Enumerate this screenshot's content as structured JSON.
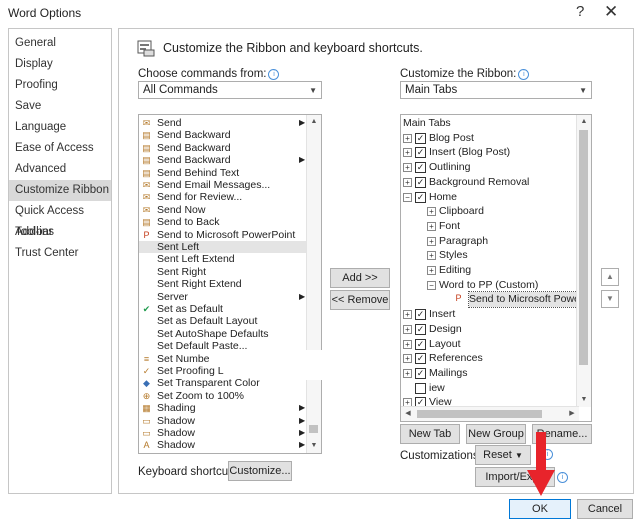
{
  "window": {
    "title": "Word Options",
    "help": "?",
    "close": "✕"
  },
  "sidebar": {
    "items": [
      {
        "label": "General"
      },
      {
        "label": "Display"
      },
      {
        "label": "Proofing"
      },
      {
        "label": "Save"
      },
      {
        "label": "Language"
      },
      {
        "label": "Ease of Access"
      },
      {
        "label": "Advanced"
      },
      {
        "label": "Customize Ribbon"
      },
      {
        "label": "Quick Access Toolbar"
      },
      {
        "label": "Add-ins"
      },
      {
        "label": "Trust Center"
      }
    ],
    "selected": "Customize Ribbon"
  },
  "header": {
    "title": "Customize the Ribbon and keyboard shortcuts."
  },
  "left": {
    "label": "Choose commands from:",
    "dropdown_value": "All Commands",
    "commands": [
      {
        "label": "Send",
        "icon": "envelope-icon",
        "submenu": true
      },
      {
        "label": "Send Backward",
        "icon": "layers-icon",
        "submenu": false
      },
      {
        "label": "Send Backward",
        "icon": "layers-icon",
        "submenu": false
      },
      {
        "label": "Send Backward",
        "icon": "layers-icon",
        "submenu": true
      },
      {
        "label": "Send Behind Text",
        "icon": "layers-icon",
        "submenu": false
      },
      {
        "label": "Send Email Messages...",
        "icon": "mail-icon",
        "submenu": false
      },
      {
        "label": "Send for Review...",
        "icon": "mail-icon",
        "submenu": false
      },
      {
        "label": "Send Now",
        "icon": "mail-icon",
        "submenu": false
      },
      {
        "label": "Send to Back",
        "icon": "layers-icon",
        "submenu": false
      },
      {
        "label": "Send to Microsoft PowerPoint",
        "icon": "powerpoint-icon",
        "submenu": false
      },
      {
        "label": "Sent Left",
        "icon": "",
        "submenu": false,
        "selected": true
      },
      {
        "label": "Sent Left Extend",
        "icon": "",
        "submenu": false
      },
      {
        "label": "Sent Right",
        "icon": "",
        "submenu": false
      },
      {
        "label": "Sent Right Extend",
        "icon": "",
        "submenu": false
      },
      {
        "label": "Server",
        "icon": "",
        "submenu": true
      },
      {
        "label": "Set as Default",
        "icon": "check-circle-icon",
        "submenu": false
      },
      {
        "label": "Set as Default Layout",
        "icon": "",
        "submenu": false
      },
      {
        "label": "Set AutoShape Defaults",
        "icon": "",
        "submenu": false
      },
      {
        "label": "Set Default Paste...",
        "icon": "",
        "submenu": false
      },
      {
        "label": "Set Numbe",
        "icon": "numbering-icon",
        "submenu": false
      },
      {
        "label": "Set Proofing L",
        "icon": "proofing-icon",
        "submenu": false
      },
      {
        "label": "Set Transparent Color",
        "icon": "color-icon",
        "submenu": false
      },
      {
        "label": "Set Zoom to 100%",
        "icon": "zoom-icon",
        "submenu": false
      },
      {
        "label": "Shading",
        "icon": "shading-icon",
        "submenu": true
      },
      {
        "label": "Shadow",
        "icon": "shadow-icon",
        "submenu": true
      },
      {
        "label": "Shadow",
        "icon": "shadow-icon",
        "submenu": true
      },
      {
        "label": "Shadow",
        "icon": "shadow-letter-icon",
        "submenu": true
      }
    ]
  },
  "middle": {
    "add": "Add >>",
    "remove": "<< Remove"
  },
  "right": {
    "label": "Customize the Ribbon:",
    "dropdown_value": "Main Tabs",
    "tree": [
      {
        "label": "Main Tabs",
        "level": 0,
        "type": "header"
      },
      {
        "label": "Blog Post",
        "level": 0,
        "pm": "+",
        "checked": true
      },
      {
        "label": "Insert (Blog Post)",
        "level": 0,
        "pm": "+",
        "checked": true
      },
      {
        "label": "Outlining",
        "level": 0,
        "pm": "+",
        "checked": true
      },
      {
        "label": "Background Removal",
        "level": 0,
        "pm": "+",
        "checked": true
      },
      {
        "label": "Home",
        "level": 0,
        "pm": "−",
        "checked": true
      },
      {
        "label": "Clipboard",
        "level": 1,
        "pm": "+"
      },
      {
        "label": "Font",
        "level": 1,
        "pm": "+"
      },
      {
        "label": "Paragraph",
        "level": 1,
        "pm": "+"
      },
      {
        "label": "Styles",
        "level": 1,
        "pm": "+"
      },
      {
        "label": "Editing",
        "level": 1,
        "pm": "+"
      },
      {
        "label": "Word to PP (Custom)",
        "level": 1,
        "pm": "−"
      },
      {
        "label": "Send to Microsoft PowerPoint",
        "level": 2,
        "selected": true
      },
      {
        "label": "Insert",
        "level": 0,
        "pm": "+",
        "checked": true
      },
      {
        "label": "Design",
        "level": 0,
        "pm": "+",
        "checked": true
      },
      {
        "label": "Layout",
        "level": 0,
        "pm": "+",
        "checked": true
      },
      {
        "label": "References",
        "level": 0,
        "pm": "+",
        "checked": true
      },
      {
        "label": "Mailings",
        "level": 0,
        "pm": "+",
        "checked": true
      },
      {
        "label": "iew",
        "level": 0,
        "pm": "",
        "checked": false,
        "partial": true
      },
      {
        "label": "View",
        "level": 0,
        "pm": "+",
        "checked": true
      },
      {
        "label": "Developer",
        "level": 0,
        "pm": "+",
        "checked": false
      }
    ],
    "buttons": {
      "new_tab": "New Tab",
      "new_group": "New Group",
      "rename": "Rename..."
    },
    "customizations_label": "Customizations:",
    "reset": "Reset",
    "import_export": "Import/Expo"
  },
  "keyboard": {
    "label": "Keyboard shortcuts:",
    "button": "Customize..."
  },
  "footer": {
    "ok": "OK",
    "cancel": "Cancel"
  },
  "colors": {
    "accent": "#e8242b",
    "selection": "#d9d9d9",
    "ok_border": "#0078d7"
  }
}
